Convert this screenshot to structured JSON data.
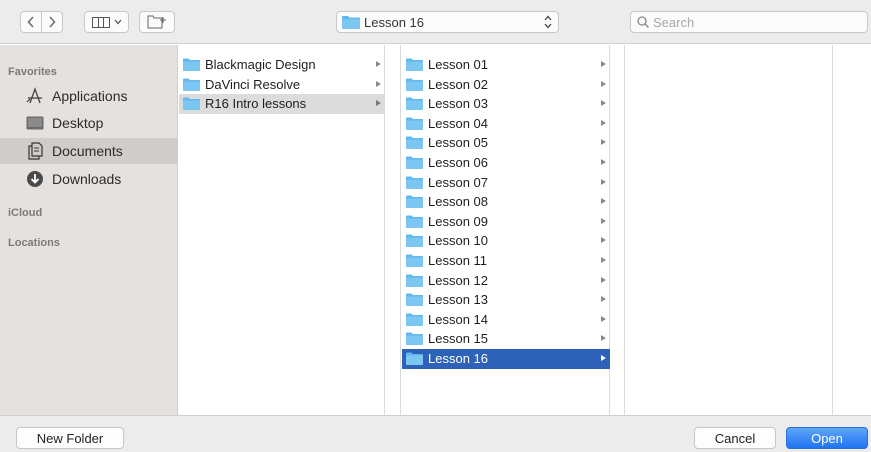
{
  "toolbar": {
    "back_icon": "chevron-left-icon",
    "forward_icon": "chevron-right-icon",
    "view_icon": "column-view-icon",
    "new_folder_icon": "new-folder-icon",
    "path_label": "Lesson 16",
    "search_placeholder": "Search"
  },
  "sidebar": {
    "favorites_header": "Favorites",
    "items": [
      {
        "label": "Applications",
        "icon": "applications-icon"
      },
      {
        "label": "Desktop",
        "icon": "desktop-icon"
      },
      {
        "label": "Documents",
        "icon": "documents-icon",
        "selected": true
      },
      {
        "label": "Downloads",
        "icon": "downloads-icon"
      }
    ],
    "icloud_header": "iCloud",
    "locations_header": "Locations"
  },
  "column1": [
    {
      "label": "Blackmagic Design"
    },
    {
      "label": "DaVinci Resolve"
    },
    {
      "label": "R16 Intro lessons",
      "selected": true
    }
  ],
  "column2": [
    {
      "label": "Lesson 01"
    },
    {
      "label": "Lesson 02"
    },
    {
      "label": "Lesson 03"
    },
    {
      "label": "Lesson 04"
    },
    {
      "label": "Lesson 05"
    },
    {
      "label": "Lesson 06"
    },
    {
      "label": "Lesson 07"
    },
    {
      "label": "Lesson 08"
    },
    {
      "label": "Lesson 09"
    },
    {
      "label": "Lesson 10"
    },
    {
      "label": "Lesson 11"
    },
    {
      "label": "Lesson 12"
    },
    {
      "label": "Lesson 13"
    },
    {
      "label": "Lesson 14"
    },
    {
      "label": "Lesson 15"
    },
    {
      "label": "Lesson 16",
      "selected": true
    }
  ],
  "buttons": {
    "new_folder": "New Folder",
    "cancel": "Cancel",
    "open": "Open"
  },
  "colors": {
    "accent": "#2e62b8",
    "folder": "#5fb8ee"
  }
}
